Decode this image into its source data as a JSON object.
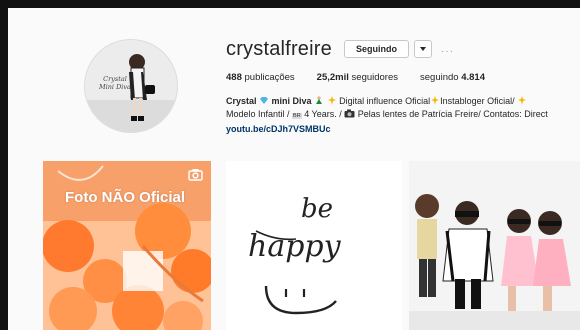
{
  "profile": {
    "username": "crystalfreire",
    "follow_label": "Seguindo",
    "more_label": "···",
    "avatar_text_line1": "Crystal",
    "avatar_text_line2": "Mini Diva"
  },
  "stats": {
    "posts_count": "488",
    "posts_label": " publicações",
    "followers_count": "25,2mil",
    "followers_label": " seguidores",
    "following_label": "seguindo ",
    "following_count": "4.814"
  },
  "bio": {
    "name": "Crystal",
    "part1": " mini Diva",
    "part2": " Digital influence Oficial",
    "part3": "Instabloger Oficial/ ",
    "part4": "Modelo Infantil / ",
    "br_badge": "BR",
    "part5": " 4 Years. / ",
    "part6": " Pelas lentes de Patrícia Freire/ Contatos: Direct",
    "link": "youtu.be/cDJh7VSMBUc"
  },
  "posts": {
    "p1_overlay": "Foto NÃO Oficial",
    "p2_text_line1": "be",
    "p2_text_line2": "happy"
  },
  "colors": {
    "link": "#003569",
    "accent_orange": "#ff8c3a",
    "page_bg": "#fafafa"
  }
}
